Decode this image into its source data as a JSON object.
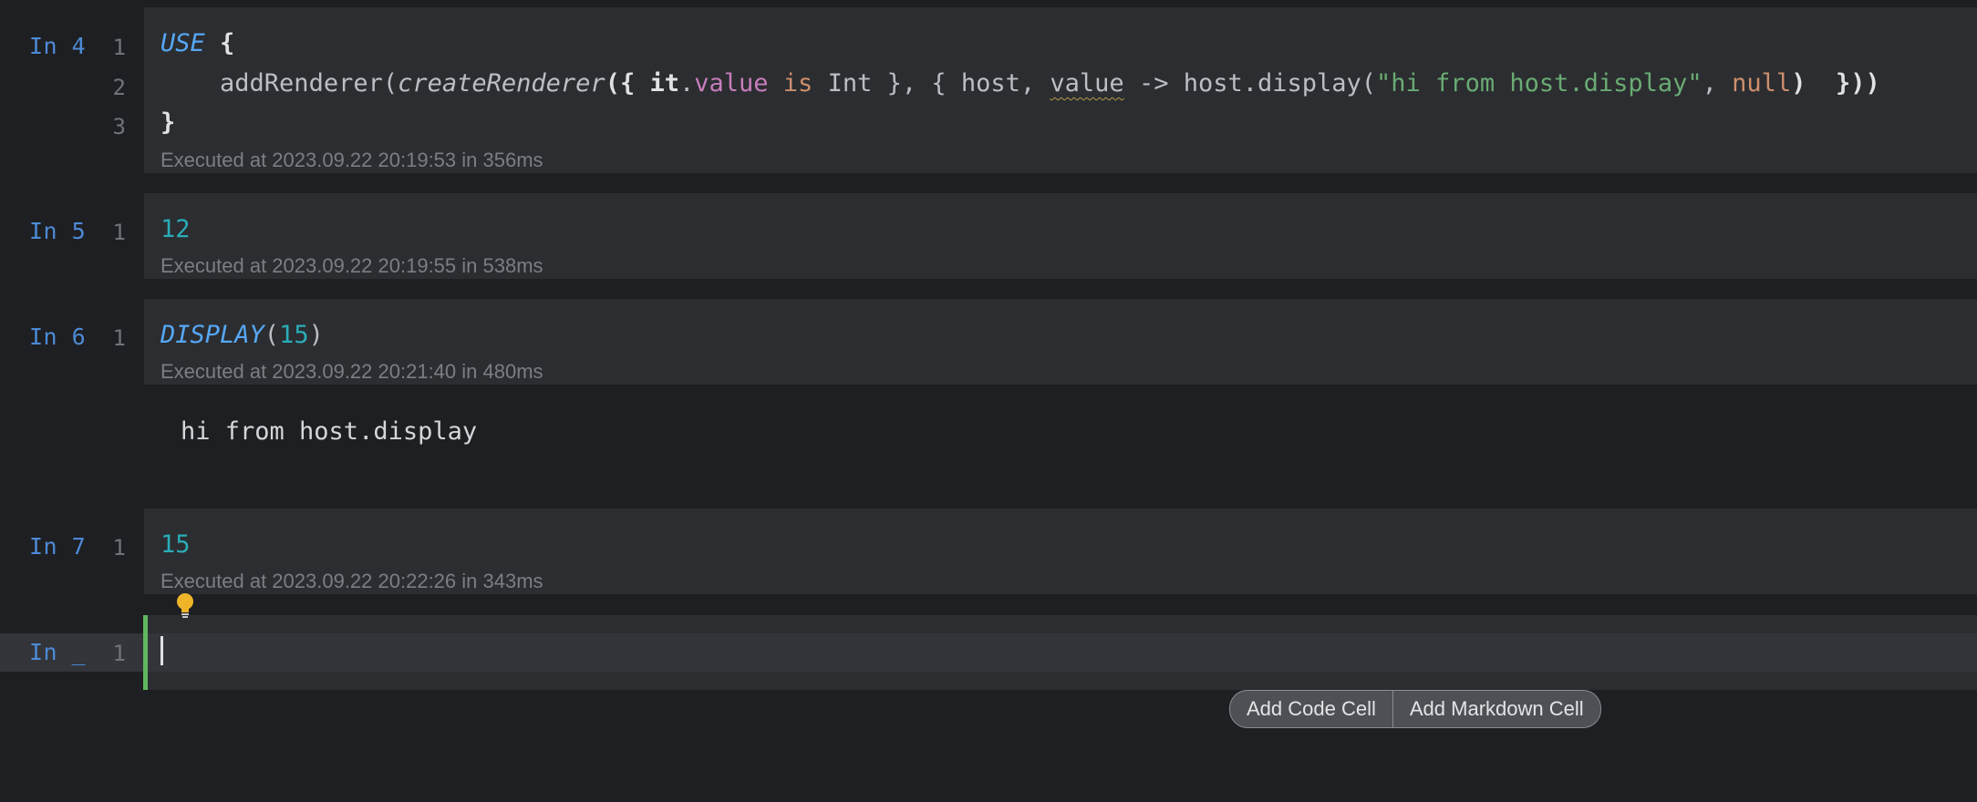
{
  "cells": [
    {
      "label": "In 4",
      "lines": [
        "1",
        "2",
        "3"
      ],
      "code": {
        "l1_kw": "USE",
        "l1_rest": " {",
        "l2_indent": "    ",
        "l2_a": "addRenderer(",
        "l2_b": "createRenderer",
        "l2_c": "({ ",
        "l2_it": "it",
        "l2_dot": ".",
        "l2_value": "value",
        "l2_sp": " ",
        "l2_is": "is",
        "l2_int": " Int }, { host, ",
        "l2_value2": "value",
        "l2_arrow": " -> host.display(",
        "l2_str": "\"hi from host.display\"",
        "l2_comma": ", ",
        "l2_null": "null",
        "l2_end": ")  }))",
        "l3": "}"
      },
      "exec": "Executed at 2023.09.22 20:19:53 in 356ms"
    },
    {
      "label": "In 5",
      "lines": [
        "1"
      ],
      "code": "12",
      "exec": "Executed at 2023.09.22 20:19:55 in 538ms"
    },
    {
      "label": "In 6",
      "lines": [
        "1"
      ],
      "code_fn": "DISPLAY",
      "code_open": "(",
      "code_arg": "15",
      "code_close": ")",
      "exec": "Executed at 2023.09.22 20:21:40 in 480ms",
      "output": "hi from host.display"
    },
    {
      "label": "In 7",
      "lines": [
        "1"
      ],
      "code": "15",
      "exec": "Executed at 2023.09.22 20:22:26 in 343ms"
    },
    {
      "label": "In _",
      "lines": [
        "1"
      ]
    }
  ],
  "buttons": {
    "add_code": "Add Code Cell",
    "add_markdown": "Add Markdown Cell"
  },
  "icons": {
    "hint": "lightbulb-icon"
  },
  "colors": {
    "accent": "#4d8ad6",
    "active_border": "#5fb85f"
  }
}
